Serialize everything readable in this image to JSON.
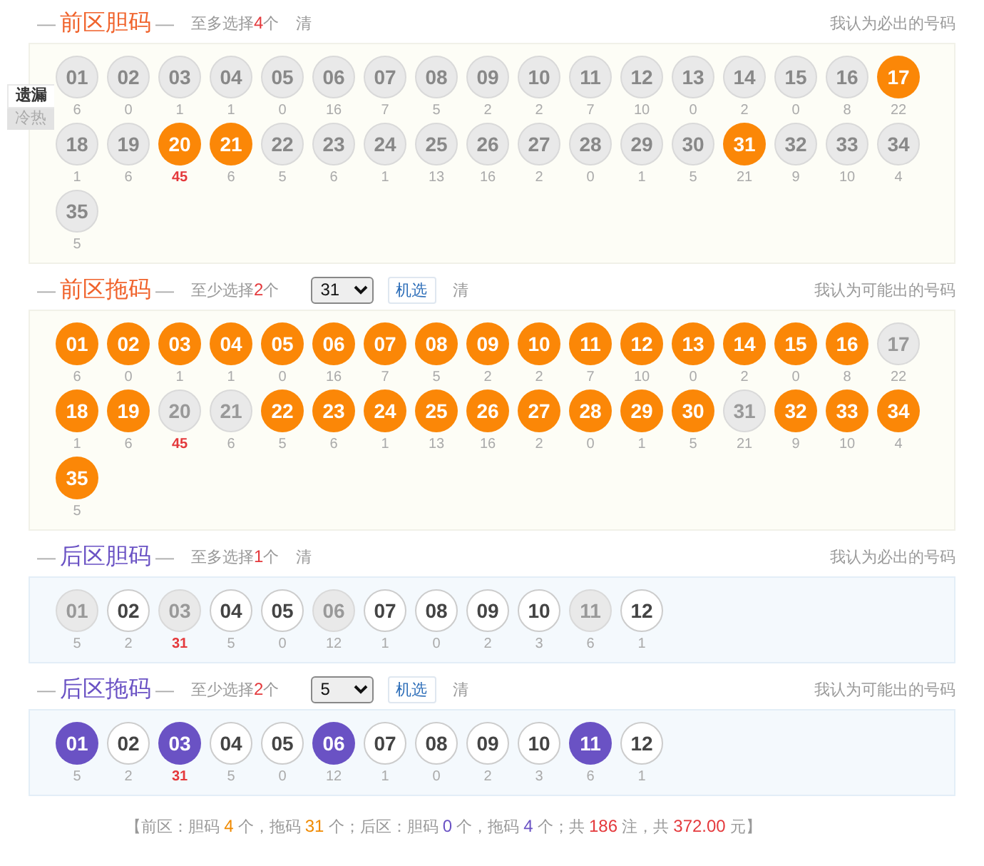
{
  "side_tabs": [
    {
      "label": "遗漏",
      "selected": true
    },
    {
      "label": "冷热",
      "selected": false
    }
  ],
  "sections": [
    {
      "kind": "front",
      "dash_left": "—",
      "title": "前区胆码",
      "dash_right": "—",
      "hint_pre": "至多选择",
      "hint_count": "4",
      "hint_post": "个",
      "clear": "清",
      "note": "我认为必出的号码",
      "balls": [
        {
          "number": "01",
          "miss": "6",
          "selected": false,
          "disabled": false,
          "hot": false
        },
        {
          "number": "02",
          "miss": "0",
          "selected": false,
          "disabled": false,
          "hot": false
        },
        {
          "number": "03",
          "miss": "1",
          "selected": false,
          "disabled": false,
          "hot": false
        },
        {
          "number": "04",
          "miss": "1",
          "selected": false,
          "disabled": false,
          "hot": false
        },
        {
          "number": "05",
          "miss": "0",
          "selected": false,
          "disabled": false,
          "hot": false
        },
        {
          "number": "06",
          "miss": "16",
          "selected": false,
          "disabled": false,
          "hot": false
        },
        {
          "number": "07",
          "miss": "7",
          "selected": false,
          "disabled": false,
          "hot": false
        },
        {
          "number": "08",
          "miss": "5",
          "selected": false,
          "disabled": false,
          "hot": false
        },
        {
          "number": "09",
          "miss": "2",
          "selected": false,
          "disabled": false,
          "hot": false
        },
        {
          "number": "10",
          "miss": "2",
          "selected": false,
          "disabled": false,
          "hot": false
        },
        {
          "number": "11",
          "miss": "7",
          "selected": false,
          "disabled": false,
          "hot": false
        },
        {
          "number": "12",
          "miss": "10",
          "selected": false,
          "disabled": false,
          "hot": false
        },
        {
          "number": "13",
          "miss": "0",
          "selected": false,
          "disabled": false,
          "hot": false
        },
        {
          "number": "14",
          "miss": "2",
          "selected": false,
          "disabled": false,
          "hot": false
        },
        {
          "number": "15",
          "miss": "0",
          "selected": false,
          "disabled": false,
          "hot": false
        },
        {
          "number": "16",
          "miss": "8",
          "selected": false,
          "disabled": false,
          "hot": false
        },
        {
          "number": "17",
          "miss": "22",
          "selected": true,
          "disabled": false,
          "hot": false
        },
        {
          "number": "18",
          "miss": "1",
          "selected": false,
          "disabled": false,
          "hot": false
        },
        {
          "number": "19",
          "miss": "6",
          "selected": false,
          "disabled": false,
          "hot": false
        },
        {
          "number": "20",
          "miss": "45",
          "selected": true,
          "disabled": false,
          "hot": true
        },
        {
          "number": "21",
          "miss": "6",
          "selected": true,
          "disabled": false,
          "hot": false
        },
        {
          "number": "22",
          "miss": "5",
          "selected": false,
          "disabled": false,
          "hot": false
        },
        {
          "number": "23",
          "miss": "6",
          "selected": false,
          "disabled": false,
          "hot": false
        },
        {
          "number": "24",
          "miss": "1",
          "selected": false,
          "disabled": false,
          "hot": false
        },
        {
          "number": "25",
          "miss": "13",
          "selected": false,
          "disabled": false,
          "hot": false
        },
        {
          "number": "26",
          "miss": "16",
          "selected": false,
          "disabled": false,
          "hot": false
        },
        {
          "number": "27",
          "miss": "2",
          "selected": false,
          "disabled": false,
          "hot": false
        },
        {
          "number": "28",
          "miss": "0",
          "selected": false,
          "disabled": false,
          "hot": false
        },
        {
          "number": "29",
          "miss": "1",
          "selected": false,
          "disabled": false,
          "hot": false
        },
        {
          "number": "30",
          "miss": "5",
          "selected": false,
          "disabled": false,
          "hot": false
        },
        {
          "number": "31",
          "miss": "21",
          "selected": true,
          "disabled": false,
          "hot": false
        },
        {
          "number": "32",
          "miss": "9",
          "selected": false,
          "disabled": false,
          "hot": false
        },
        {
          "number": "33",
          "miss": "10",
          "selected": false,
          "disabled": false,
          "hot": false
        },
        {
          "number": "34",
          "miss": "4",
          "selected": false,
          "disabled": false,
          "hot": false
        },
        {
          "number": "35",
          "miss": "5",
          "selected": false,
          "disabled": false,
          "hot": false
        }
      ]
    },
    {
      "kind": "front",
      "dash_left": "—",
      "title": "前区拖码",
      "dash_right": "—",
      "hint_pre": "至少选择",
      "hint_count": "2",
      "hint_post": "个",
      "select": "31",
      "random": "机选",
      "clear": "清",
      "note": "我认为可能出的号码",
      "balls": [
        {
          "number": "01",
          "miss": "6",
          "selected": true,
          "disabled": false,
          "hot": false
        },
        {
          "number": "02",
          "miss": "0",
          "selected": true,
          "disabled": false,
          "hot": false
        },
        {
          "number": "03",
          "miss": "1",
          "selected": true,
          "disabled": false,
          "hot": false
        },
        {
          "number": "04",
          "miss": "1",
          "selected": true,
          "disabled": false,
          "hot": false
        },
        {
          "number": "05",
          "miss": "0",
          "selected": true,
          "disabled": false,
          "hot": false
        },
        {
          "number": "06",
          "miss": "16",
          "selected": true,
          "disabled": false,
          "hot": false
        },
        {
          "number": "07",
          "miss": "7",
          "selected": true,
          "disabled": false,
          "hot": false
        },
        {
          "number": "08",
          "miss": "5",
          "selected": true,
          "disabled": false,
          "hot": false
        },
        {
          "number": "09",
          "miss": "2",
          "selected": true,
          "disabled": false,
          "hot": false
        },
        {
          "number": "10",
          "miss": "2",
          "selected": true,
          "disabled": false,
          "hot": false
        },
        {
          "number": "11",
          "miss": "7",
          "selected": true,
          "disabled": false,
          "hot": false
        },
        {
          "number": "12",
          "miss": "10",
          "selected": true,
          "disabled": false,
          "hot": false
        },
        {
          "number": "13",
          "miss": "0",
          "selected": true,
          "disabled": false,
          "hot": false
        },
        {
          "number": "14",
          "miss": "2",
          "selected": true,
          "disabled": false,
          "hot": false
        },
        {
          "number": "15",
          "miss": "0",
          "selected": true,
          "disabled": false,
          "hot": false
        },
        {
          "number": "16",
          "miss": "8",
          "selected": true,
          "disabled": false,
          "hot": false
        },
        {
          "number": "17",
          "miss": "22",
          "selected": false,
          "disabled": true,
          "hot": false
        },
        {
          "number": "18",
          "miss": "1",
          "selected": true,
          "disabled": false,
          "hot": false
        },
        {
          "number": "19",
          "miss": "6",
          "selected": true,
          "disabled": false,
          "hot": false
        },
        {
          "number": "20",
          "miss": "45",
          "selected": false,
          "disabled": true,
          "hot": true
        },
        {
          "number": "21",
          "miss": "6",
          "selected": false,
          "disabled": true,
          "hot": false
        },
        {
          "number": "22",
          "miss": "5",
          "selected": true,
          "disabled": false,
          "hot": false
        },
        {
          "number": "23",
          "miss": "6",
          "selected": true,
          "disabled": false,
          "hot": false
        },
        {
          "number": "24",
          "miss": "1",
          "selected": true,
          "disabled": false,
          "hot": false
        },
        {
          "number": "25",
          "miss": "13",
          "selected": true,
          "disabled": false,
          "hot": false
        },
        {
          "number": "26",
          "miss": "16",
          "selected": true,
          "disabled": false,
          "hot": false
        },
        {
          "number": "27",
          "miss": "2",
          "selected": true,
          "disabled": false,
          "hot": false
        },
        {
          "number": "28",
          "miss": "0",
          "selected": true,
          "disabled": false,
          "hot": false
        },
        {
          "number": "29",
          "miss": "1",
          "selected": true,
          "disabled": false,
          "hot": false
        },
        {
          "number": "30",
          "miss": "5",
          "selected": true,
          "disabled": false,
          "hot": false
        },
        {
          "number": "31",
          "miss": "21",
          "selected": false,
          "disabled": true,
          "hot": false
        },
        {
          "number": "32",
          "miss": "9",
          "selected": true,
          "disabled": false,
          "hot": false
        },
        {
          "number": "33",
          "miss": "10",
          "selected": true,
          "disabled": false,
          "hot": false
        },
        {
          "number": "34",
          "miss": "4",
          "selected": true,
          "disabled": false,
          "hot": false
        },
        {
          "number": "35",
          "miss": "5",
          "selected": true,
          "disabled": false,
          "hot": false
        }
      ]
    },
    {
      "kind": "back",
      "dash_left": "—",
      "title": "后区胆码",
      "dash_right": "—",
      "hint_pre": "至多选择",
      "hint_count": "1",
      "hint_post": "个",
      "clear": "清",
      "note": "我认为必出的号码",
      "balls": [
        {
          "number": "01",
          "miss": "5",
          "selected": false,
          "disabled": true,
          "hot": false
        },
        {
          "number": "02",
          "miss": "2",
          "selected": false,
          "disabled": false,
          "hot": false
        },
        {
          "number": "03",
          "miss": "31",
          "selected": false,
          "disabled": true,
          "hot": true
        },
        {
          "number": "04",
          "miss": "5",
          "selected": false,
          "disabled": false,
          "hot": false
        },
        {
          "number": "05",
          "miss": "0",
          "selected": false,
          "disabled": false,
          "hot": false
        },
        {
          "number": "06",
          "miss": "12",
          "selected": false,
          "disabled": true,
          "hot": false
        },
        {
          "number": "07",
          "miss": "1",
          "selected": false,
          "disabled": false,
          "hot": false
        },
        {
          "number": "08",
          "miss": "0",
          "selected": false,
          "disabled": false,
          "hot": false
        },
        {
          "number": "09",
          "miss": "2",
          "selected": false,
          "disabled": false,
          "hot": false
        },
        {
          "number": "10",
          "miss": "3",
          "selected": false,
          "disabled": false,
          "hot": false
        },
        {
          "number": "11",
          "miss": "6",
          "selected": false,
          "disabled": true,
          "hot": false
        },
        {
          "number": "12",
          "miss": "1",
          "selected": false,
          "disabled": false,
          "hot": false
        }
      ]
    },
    {
      "kind": "back",
      "dash_left": "—",
      "title": "后区拖码",
      "dash_right": "—",
      "hint_pre": "至少选择",
      "hint_count": "2",
      "hint_post": "个",
      "select": "5",
      "random": "机选",
      "clear": "清",
      "note": "我认为可能出的号码",
      "balls": [
        {
          "number": "01",
          "miss": "5",
          "selected": true,
          "disabled": false,
          "hot": false
        },
        {
          "number": "02",
          "miss": "2",
          "selected": false,
          "disabled": false,
          "hot": false
        },
        {
          "number": "03",
          "miss": "31",
          "selected": true,
          "disabled": false,
          "hot": true
        },
        {
          "number": "04",
          "miss": "5",
          "selected": false,
          "disabled": false,
          "hot": false
        },
        {
          "number": "05",
          "miss": "0",
          "selected": false,
          "disabled": false,
          "hot": false
        },
        {
          "number": "06",
          "miss": "12",
          "selected": true,
          "disabled": false,
          "hot": false
        },
        {
          "number": "07",
          "miss": "1",
          "selected": false,
          "disabled": false,
          "hot": false
        },
        {
          "number": "08",
          "miss": "0",
          "selected": false,
          "disabled": false,
          "hot": false
        },
        {
          "number": "09",
          "miss": "2",
          "selected": false,
          "disabled": false,
          "hot": false
        },
        {
          "number": "10",
          "miss": "3",
          "selected": false,
          "disabled": false,
          "hot": false
        },
        {
          "number": "11",
          "miss": "6",
          "selected": true,
          "disabled": false,
          "hot": false
        },
        {
          "number": "12",
          "miss": "1",
          "selected": false,
          "disabled": false,
          "hot": false
        }
      ]
    }
  ],
  "summary": [
    {
      "text": "【前区：胆码 ",
      "kind": "plain"
    },
    {
      "text": "4",
      "kind": "front"
    },
    {
      "text": " 个，拖码 ",
      "kind": "plain"
    },
    {
      "text": "31",
      "kind": "front"
    },
    {
      "text": " 个；后区：胆码 ",
      "kind": "plain"
    },
    {
      "text": "0",
      "kind": "back"
    },
    {
      "text": " 个，拖码 ",
      "kind": "plain"
    },
    {
      "text": "4",
      "kind": "back"
    },
    {
      "text": " 个；共 ",
      "kind": "plain"
    },
    {
      "text": "186",
      "kind": "total"
    },
    {
      "text": " 注，共 ",
      "kind": "plain"
    },
    {
      "text": "372.00",
      "kind": "total"
    },
    {
      "text": " 元】",
      "kind": "plain"
    }
  ]
}
